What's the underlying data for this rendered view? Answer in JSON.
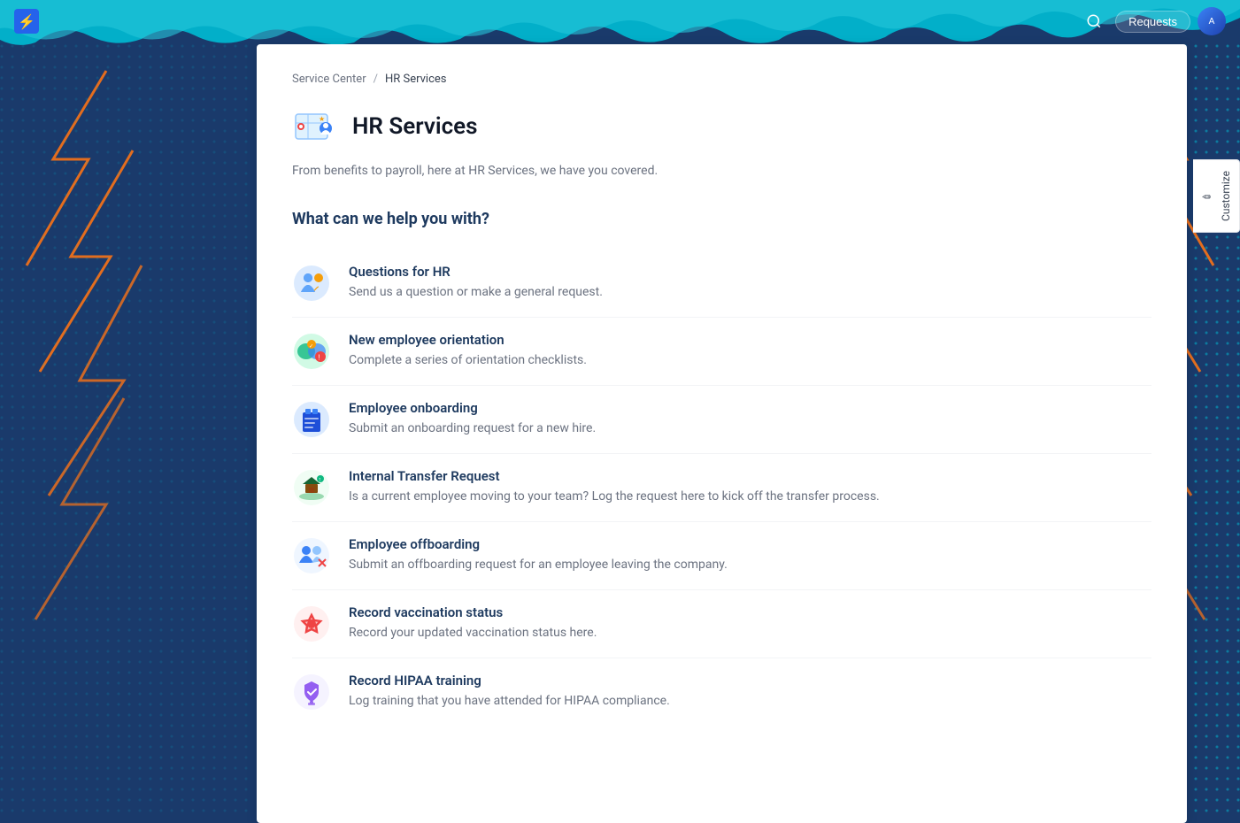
{
  "header": {
    "logo_icon": "⚡",
    "search_label": "Search",
    "requests_label": "Requests",
    "atlas_label": "A"
  },
  "breadcrumb": {
    "parent": "Service Center",
    "separator": "/",
    "current": "HR Services"
  },
  "page": {
    "title": "HR Services",
    "description": "From benefits to payroll, here at HR Services, we have you covered.",
    "section_heading": "What can we help you with?"
  },
  "services": [
    {
      "id": "questions-for-hr",
      "title": "Questions for HR",
      "description": "Send us a question or make a general request.",
      "icon": "🌐"
    },
    {
      "id": "new-employee-orientation",
      "title": "New employee orientation",
      "description": "Complete a series of orientation checklists.",
      "icon": "🌍"
    },
    {
      "id": "employee-onboarding",
      "title": "Employee onboarding",
      "description": "Submit an onboarding request for a new hire.",
      "icon": "👕"
    },
    {
      "id": "internal-transfer-request",
      "title": "Internal Transfer Request",
      "description": "Is a current employee moving to your team? Log the request here to kick off the transfer process.",
      "icon": "🌱"
    },
    {
      "id": "employee-offboarding",
      "title": "Employee offboarding",
      "description": "Submit an offboarding request for an employee leaving the company.",
      "icon": "👥"
    },
    {
      "id": "record-vaccination-status",
      "title": "Record vaccination status",
      "description": "Record your updated vaccination status here.",
      "icon": "❤️"
    },
    {
      "id": "record-hipaa-training",
      "title": "Record HIPAA training",
      "description": "Log training that you have attended for HIPAA compliance.",
      "icon": "⚖️"
    }
  ],
  "customize": {
    "label": "Customize",
    "icon": "✏️"
  }
}
